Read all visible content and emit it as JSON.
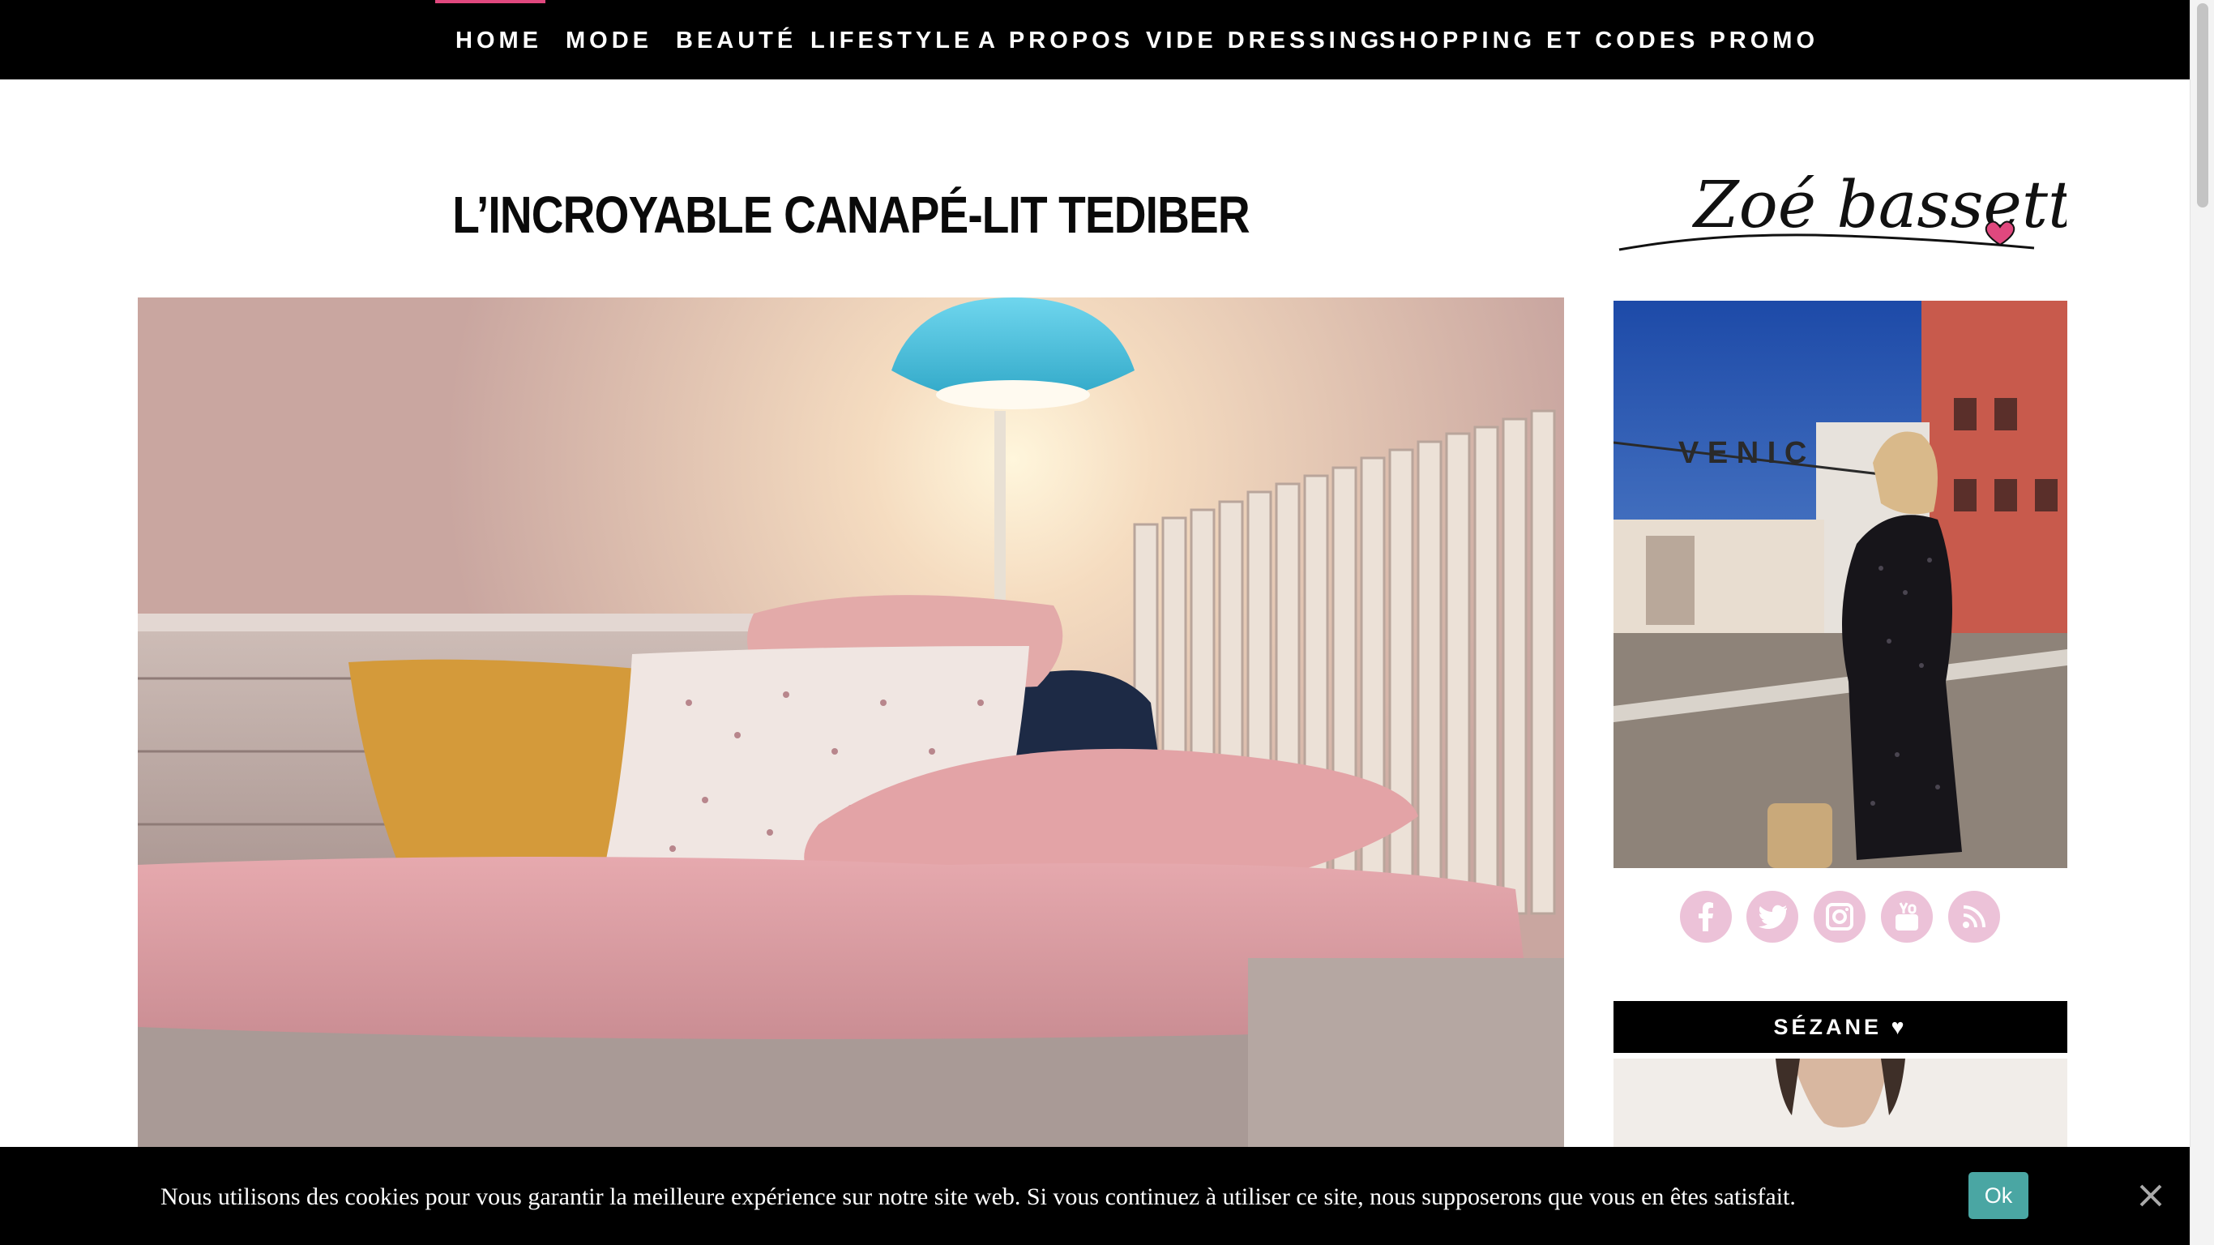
{
  "nav": {
    "items": [
      {
        "label": "HOME"
      },
      {
        "label": "MODE"
      },
      {
        "label": "BEAUTÉ"
      },
      {
        "label": "LIFESTYLE"
      },
      {
        "label": "A PROPOS"
      },
      {
        "label": "VIDE DRESSING"
      },
      {
        "label": "SHOPPING ET CODES PROMO"
      }
    ],
    "accent_color": "#e0487e"
  },
  "post": {
    "title": "L’INCROYABLE CANAPÉ-LIT TEDIBER"
  },
  "sidebar": {
    "logo_text": "Zoé bassetto",
    "photo_sign_text": "V E N I C",
    "social": [
      {
        "icon": "facebook-icon"
      },
      {
        "icon": "twitter-icon"
      },
      {
        "icon": "instagram-icon"
      },
      {
        "icon": "youtube-icon"
      },
      {
        "icon": "rss-icon"
      }
    ],
    "social_color": "#ecc2d8",
    "widget_title": "SÉZANE ♥"
  },
  "cookie": {
    "text": "Nous utilisons des cookies pour vous garantir la meilleure expérience sur notre site web. Si vous continuez à utiliser ce site, nous supposerons que vous en êtes satisfait.",
    "ok_label": "Ok",
    "ok_color": "#4aa6a3"
  }
}
